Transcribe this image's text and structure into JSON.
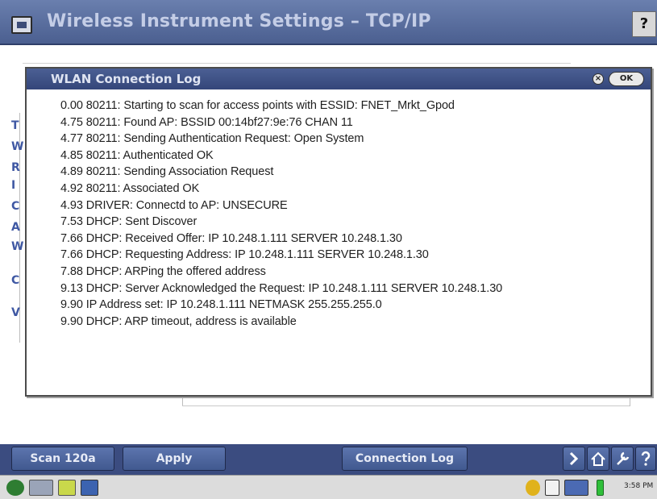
{
  "window": {
    "title": "Wireless Instrument Settings – TCP/IP",
    "help_label": "?"
  },
  "background": {
    "left_labels": [
      "T",
      "W",
      "R",
      "I",
      "C",
      "A",
      "W",
      "C",
      "V"
    ]
  },
  "dialog": {
    "title": "WLAN Connection Log",
    "close_label": "×",
    "ok_label": "OK",
    "log_lines": [
      "0.00 80211: Starting to scan for access points with ESSID: FNET_Mrkt_Gpod",
      "4.75 80211: Found AP: BSSID 00:14bf27:9e:76  CHAN 11",
      "4.77 80211: Sending Authentication Request: Open System",
      "4.85 80211: Authenticated OK",
      "4.89 80211: Sending Association Request",
      "4.92 80211: Associated OK",
      "4.93 DRIVER: Connectd to AP: UNSECURE",
      "7.53 DHCP: Sent Discover",
      "7.66 DHCP: Received Offer: IP 10.248.1.111  SERVER 10.248.1.30",
      "7.66 DHCP: Requesting Address: IP 10.248.1.111  SERVER 10.248.1.30",
      "7.88 DHCP: ARPing the offered address",
      "9.13 DHCP: Server Acknowledged the Request: IP 10.248.1.111  SERVER 10.248.1.30",
      "9.90 IP Address set: IP 10.248.1.111  NETMASK 255.255.255.0",
      "9.90 DHCP: ARP timeout, address is available"
    ]
  },
  "buttonbar": {
    "scan_label": "Scan 120a",
    "apply_label": "Apply",
    "connection_log_label": "Connection Log"
  },
  "taskbar": {
    "clock": "3:58 PM"
  },
  "colors": {
    "title_bar": "#4f6396",
    "dialog_title_bar": "#3c4f84",
    "button_bar": "#3b4c80",
    "battery": "#2fbf3a"
  },
  "icons": {
    "title": "window-icon",
    "close": "close-icon",
    "forward": "chevron-right-icon",
    "home": "home-icon",
    "tools": "wrench-icon",
    "help": "question-icon"
  }
}
